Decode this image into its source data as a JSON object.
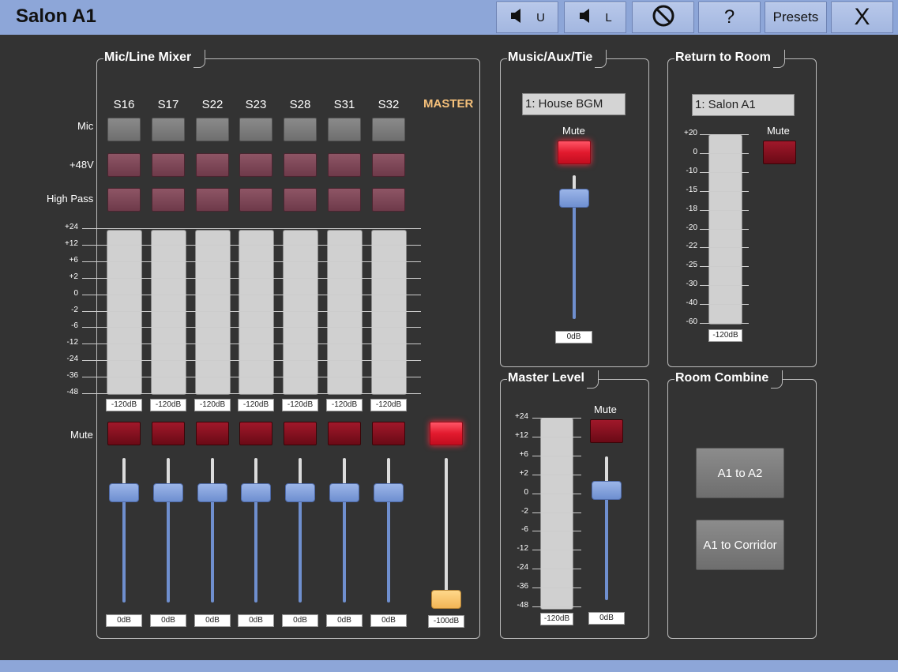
{
  "header": {
    "title": "Salon A1",
    "buttons": {
      "upper_label": "U",
      "lower_label": "L",
      "presets_label": "Presets",
      "help_label": "?",
      "close_label": "X"
    }
  },
  "mixer": {
    "title": "Mic/Line Mixer",
    "row_labels": {
      "mic": "Mic",
      "phantom": "+48V",
      "highpass": "High Pass",
      "mute": "Mute"
    },
    "channels": [
      {
        "name": "S16",
        "meter": "-120dB",
        "level": "0dB"
      },
      {
        "name": "S17",
        "meter": "-120dB",
        "level": "0dB"
      },
      {
        "name": "S22",
        "meter": "-120dB",
        "level": "0dB"
      },
      {
        "name": "S23",
        "meter": "-120dB",
        "level": "0dB"
      },
      {
        "name": "S28",
        "meter": "-120dB",
        "level": "0dB"
      },
      {
        "name": "S31",
        "meter": "-120dB",
        "level": "0dB"
      },
      {
        "name": "S32",
        "meter": "-120dB",
        "level": "0dB"
      }
    ],
    "master": {
      "label": "MASTER",
      "level": "-100dB",
      "muted": true
    },
    "scale": [
      "+24",
      "+12",
      "+6",
      "+2",
      "0",
      "-2",
      "-6",
      "-12",
      "-24",
      "-36",
      "-48"
    ]
  },
  "music": {
    "title": "Music/Aux/Tie",
    "source": "1: House BGM",
    "mute_label": "Mute",
    "level": "0dB",
    "muted": true
  },
  "return": {
    "title": "Return to Room",
    "source": "1: Salon A1",
    "mute_label": "Mute",
    "meter": "-120dB",
    "scale": [
      "+20",
      "0",
      "-10",
      "-15",
      "-18",
      "-20",
      "-22",
      "-25",
      "-30",
      "-40",
      "-60"
    ]
  },
  "master_level": {
    "title": "Master Level",
    "mute_label": "Mute",
    "meter": "-120dB",
    "level": "0dB",
    "scale": [
      "+24",
      "+12",
      "+6",
      "+2",
      "0",
      "-2",
      "-6",
      "-12",
      "-24",
      "-36",
      "-48"
    ]
  },
  "combine": {
    "title": "Room Combine",
    "buttons": [
      "A1 to A2",
      "A1 to Corridor"
    ]
  },
  "colors": {
    "header": "#8da6d8",
    "background": "#333333",
    "master_accent": "#f5c07a",
    "mute_active": "#e21a2e",
    "fader": "#6f8fcf"
  }
}
